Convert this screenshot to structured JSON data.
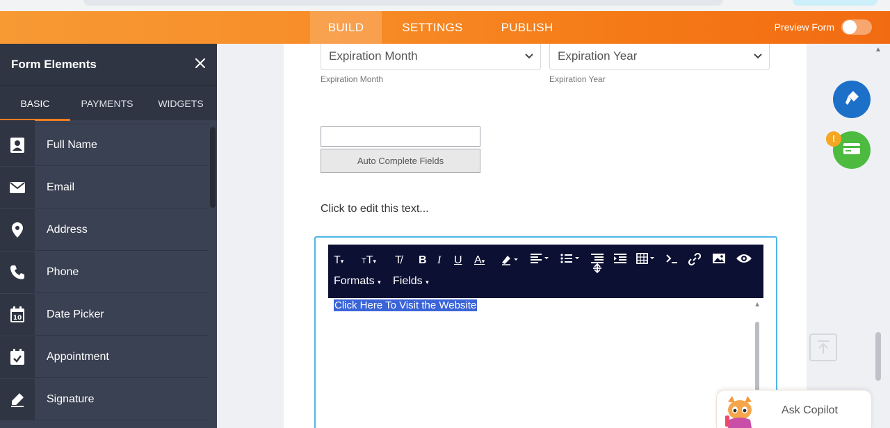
{
  "topbar": {
    "tabs": [
      {
        "label": "BUILD",
        "active": true
      },
      {
        "label": "SETTINGS",
        "active": false
      },
      {
        "label": "PUBLISH",
        "active": false
      }
    ],
    "preview_label": "Preview Form",
    "colors": {
      "gradient_start": "#f79a34",
      "gradient_end": "#f26b12"
    }
  },
  "sidebar": {
    "title": "Form Elements",
    "close_icon": "close-icon",
    "tabs": [
      {
        "label": "BASIC",
        "active": true
      },
      {
        "label": "PAYMENTS",
        "active": false
      },
      {
        "label": "WIDGETS",
        "active": false
      }
    ],
    "items": [
      {
        "label": "Full Name",
        "icon": "user-card-icon"
      },
      {
        "label": "Email",
        "icon": "envelope-icon"
      },
      {
        "label": "Address",
        "icon": "location-pin-icon"
      },
      {
        "label": "Phone",
        "icon": "phone-icon"
      },
      {
        "label": "Date Picker",
        "icon": "calendar-icon"
      },
      {
        "label": "Appointment",
        "icon": "calendar-check-icon"
      },
      {
        "label": "Signature",
        "icon": "pen-icon"
      }
    ],
    "accent": "#f47d20"
  },
  "form": {
    "expiration_month": {
      "value": "Expiration Month",
      "sublabel": "Expiration Month"
    },
    "expiration_year": {
      "value": "Expiration Year",
      "sublabel": "Expiration Year"
    },
    "auto_complete_button": "Auto Complete Fields",
    "edit_text": "Click to edit this text...",
    "editor": {
      "toolbar_row2": {
        "formats": "Formats",
        "fields": "Fields"
      },
      "selected_text": "Click Here To Visit the Website"
    }
  },
  "right_panel": {
    "badge": "!",
    "copilot_label": "Ask Copilot"
  }
}
